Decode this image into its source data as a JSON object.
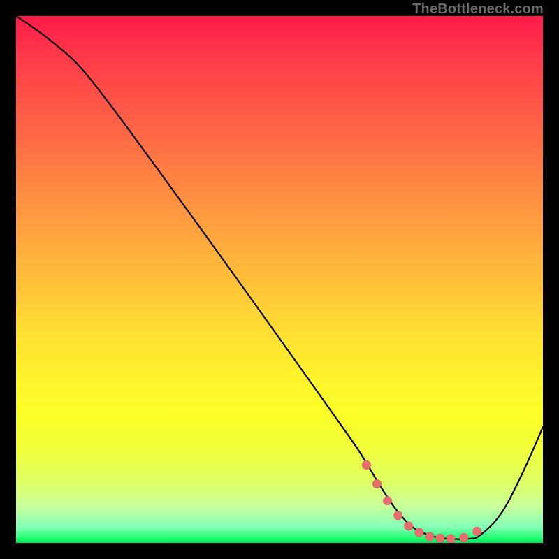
{
  "attribution": "TheBottleneck.com",
  "colors": {
    "page_bg": "#000000",
    "curve_stroke": "#000000",
    "marker_fill": "#e56e6e",
    "marker_stroke": "#d85a5a"
  },
  "chart_data": {
    "type": "line",
    "title": "",
    "xlabel": "",
    "ylabel": "",
    "xlim": [
      0,
      100
    ],
    "ylim": [
      0,
      100
    ],
    "grid": false,
    "legend": false,
    "series": [
      {
        "name": "bottleneck-curve",
        "x": [
          0,
          3,
          7,
          12,
          18,
          25,
          33,
          42,
          52,
          63,
          66,
          69,
          72,
          75,
          78,
          81,
          84,
          86,
          88,
          92,
          96,
          100
        ],
        "y": [
          100,
          98,
          95,
          90.5,
          83,
          73.5,
          62.5,
          50,
          36,
          20.5,
          16,
          11,
          6.5,
          3.2,
          1.6,
          0.9,
          0.7,
          0.8,
          1.4,
          5.5,
          13,
          22
        ]
      }
    ],
    "markers": {
      "name": "trough-markers",
      "x": [
        66.5,
        68.5,
        70.5,
        72.5,
        74.5,
        76.5,
        78.5,
        80.5,
        82.5,
        85.0,
        87.5
      ],
      "y": [
        14.8,
        11.2,
        8.0,
        5.2,
        3.2,
        2.0,
        1.2,
        0.9,
        0.8,
        1.0,
        2.2
      ]
    }
  }
}
